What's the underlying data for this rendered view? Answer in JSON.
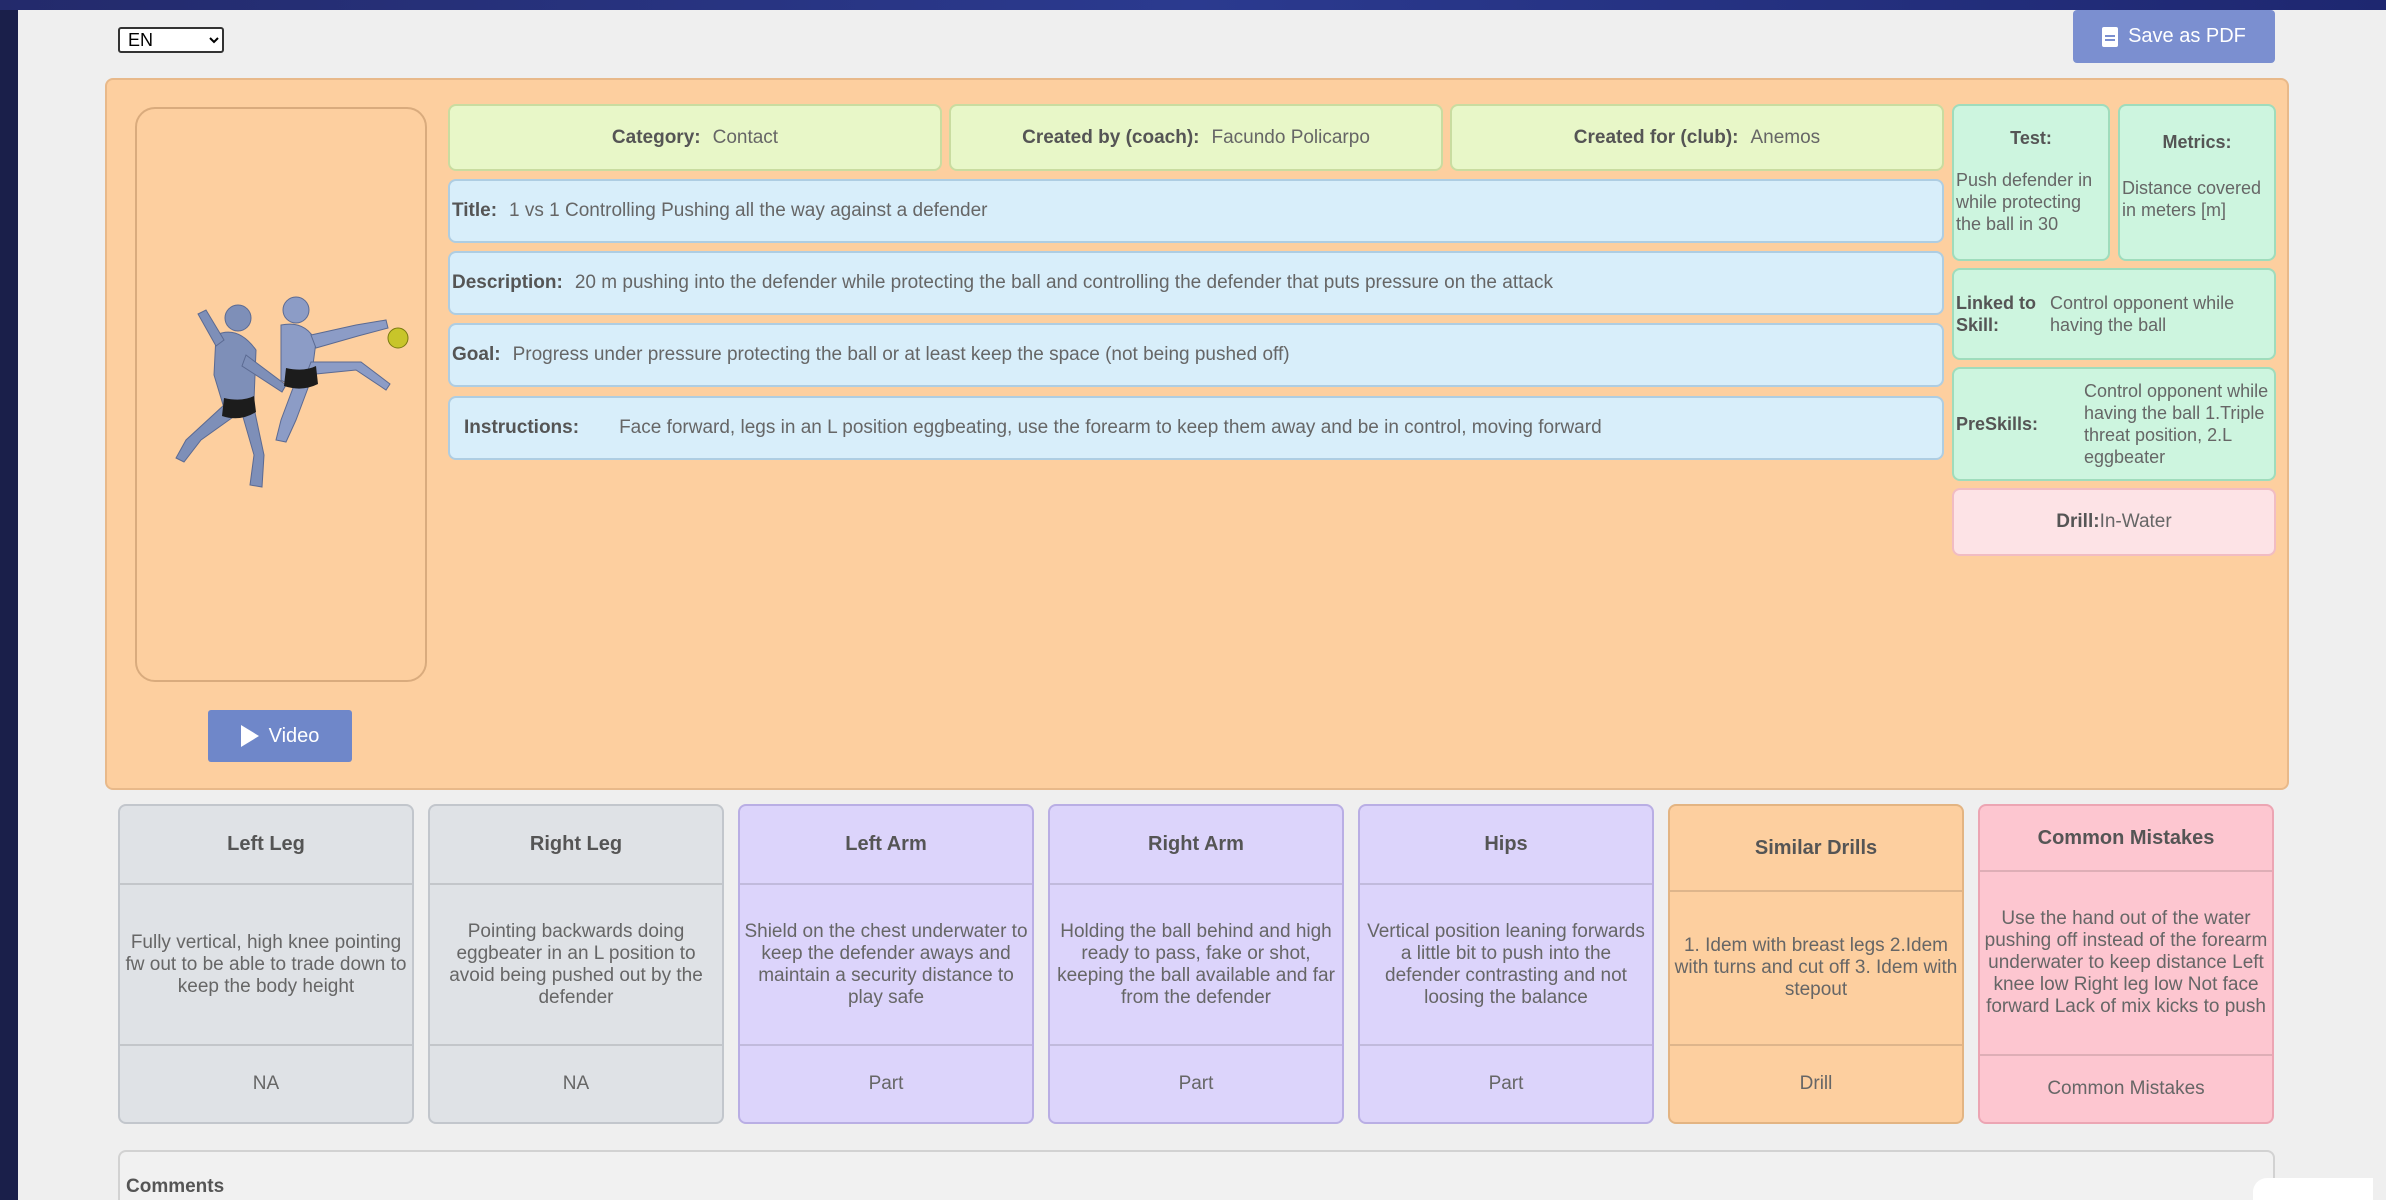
{
  "language": {
    "selected": "EN"
  },
  "toolbar": {
    "save_pdf_label": "Save as PDF"
  },
  "video": {
    "label": "Video"
  },
  "meta": {
    "category_label": "Category:",
    "category_value": "Contact",
    "coach_label": "Created by (coach):",
    "coach_value": "Facundo Policarpo",
    "club_label": "Created for (club):",
    "club_value": "Anemos"
  },
  "details": {
    "title_label": "Title:",
    "title_value": "1 vs 1 Controlling Pushing all the way against a defender",
    "description_label": "Description:",
    "description_value": "20 m pushing into the defender while protecting the ball and controlling the defender that puts pressure on the attack",
    "goal_label": "Goal:",
    "goal_value": "Progress under pressure protecting the ball or at least keep the space (not being pushed off)",
    "instructions_label": "Instructions:",
    "instructions_value": "Face forward, legs in an L position eggbeating, use the forearm to keep them away and be in control, moving forward"
  },
  "side": {
    "test_label": "Test:",
    "test_value": "Push defender in while protecting the ball in 30",
    "metrics_label": "Metrics:",
    "metrics_value": "Distance covered in meters [m]",
    "linked_label": "Linked to Skill:",
    "linked_value": "Control opponent while having the ball",
    "preskills_label": "PreSkills:",
    "preskills_value": "Control opponent while having the ball 1.Triple threat position, 2.L eggbeater",
    "drill_label": "Drill:",
    "drill_value": "In-Water"
  },
  "cards": [
    {
      "title": "Left Leg",
      "body": "Fully vertical, high knee pointing fw out to be able to trade down to keep the body height",
      "footer": "NA"
    },
    {
      "title": "Right Leg",
      "body": "Pointing backwards doing eggbeater in an L position to avoid being pushed out by the defender",
      "footer": "NA"
    },
    {
      "title": "Left Arm",
      "body": "Shield on the chest underwater to keep the defender aways and maintain a security distance to play safe",
      "footer": "Part"
    },
    {
      "title": "Right Arm",
      "body": "Holding the ball behind and high ready to pass, fake or shot, keeping the ball available and far from the defender",
      "footer": "Part"
    },
    {
      "title": "Hips",
      "body": "Vertical position leaning forwards a little bit to push into the defender contrasting and not loosing the balance",
      "footer": "Part"
    },
    {
      "title": "Similar Drills",
      "body": "1. Idem with breast legs 2.Idem with turns and cut off 3. Idem with stepout",
      "footer": "Drill"
    },
    {
      "title": "Common Mistakes",
      "body": "Use the hand out of the water pushing off instead of the forearm underwater to keep distance Left knee low Right leg low Not face forward Lack of mix kicks to push",
      "footer": "Common Mistakes"
    }
  ],
  "comments": {
    "label": "Comments"
  },
  "icons": {
    "pdf": "file-pdf-icon",
    "play": "play-icon"
  },
  "colors": {
    "main_card": "#fdcf9f",
    "meta_box": "#e8f7c8",
    "detail_box": "#d8eefa",
    "side_box": "#cdf5df",
    "drill_box": "#fde3e6",
    "legs_card": "#dfe2e6",
    "arms_hips_card": "#dcd4fb",
    "similar_card": "#fdcf9f",
    "mistakes_card": "#fdc6d0",
    "button": "#7b8fd0"
  }
}
